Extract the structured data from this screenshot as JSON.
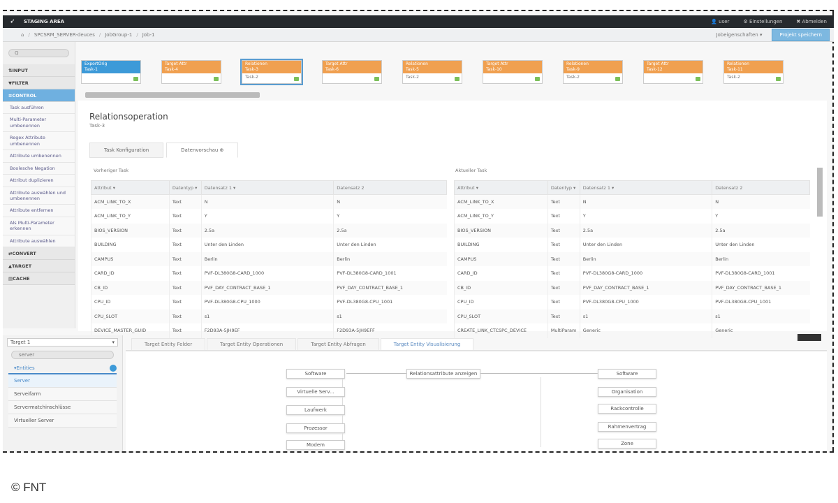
{
  "app": {
    "title": "STAGING AREA",
    "user": "user",
    "settings": "Einstellungen",
    "logout": "Abmelden"
  },
  "breadcrumb": {
    "items": [
      "SPCSRM_SERVER-deuces",
      "JobGroup-1",
      "Job-1"
    ],
    "dropdown": "Jobeigenschaften",
    "save": "Projekt speichern"
  },
  "sidebar": {
    "search": "Q",
    "categories": [
      "INPUT",
      "FILTER",
      "CONTROL"
    ],
    "items": [
      "Task ausführen",
      "Multi-Parameter umbenennen",
      "Regex Attribute umbenennen",
      "Attribute umbenennen",
      "Boolesche Negation",
      "Attribut duplizieren",
      "Attribute auswählen und umbenennen",
      "Attribute entfernen",
      "Als Multi-Parameter erkennen",
      "Attribute auswählen"
    ],
    "bottom_categories": [
      "CONVERT",
      "TARGET",
      "CACHE"
    ]
  },
  "tasks": [
    {
      "type": "ExportOrig",
      "name": "Task-1",
      "foot": "",
      "color": "blue"
    },
    {
      "type": "Target Attr",
      "name": "Task-4",
      "foot": "",
      "color": "orange"
    },
    {
      "type": "Relationen",
      "name": "Task-3",
      "foot": "Task-2",
      "color": "orange"
    },
    {
      "type": "Target Attr",
      "name": "Task-6",
      "foot": "",
      "color": "orange"
    },
    {
      "type": "Relationen",
      "name": "Task-5",
      "foot": "Task-2",
      "color": "orange"
    },
    {
      "type": "Target Attr",
      "name": "Task-10",
      "foot": "",
      "color": "orange"
    },
    {
      "type": "Relationen",
      "name": "Task-9",
      "foot": "Task-2",
      "color": "orange"
    },
    {
      "type": "Target Attr",
      "name": "Task-12",
      "foot": "",
      "color": "orange"
    },
    {
      "type": "Relationen",
      "name": "Task-11",
      "foot": "Task-2",
      "color": "orange"
    }
  ],
  "panel": {
    "title": "Relationsoperation",
    "subtitle": "Task-3",
    "tabs": [
      "Task Konfiguration",
      "Datenvorschau"
    ],
    "left_title": "Vorheriger Task",
    "right_title": "Aktueller Task",
    "left_headers": [
      "Attribut",
      "Datentyp",
      "Datensatz 1",
      "Datensatz 2"
    ],
    "right_headers": [
      "Attribut",
      "Datentyp",
      "Datensatz 1",
      "Datensatz 2"
    ],
    "left_rows": [
      [
        "ACM_LINK_TO_X",
        "Text",
        "N",
        "N"
      ],
      [
        "ACM_LINK_TO_Y",
        "Text",
        "Y",
        "Y"
      ],
      [
        "BIOS_VERSION",
        "Text",
        "2.5a",
        "2.5a"
      ],
      [
        "BUILDING",
        "Text",
        "Unter den Linden",
        "Unter den Linden"
      ],
      [
        "CAMPUS",
        "Text",
        "Berlin",
        "Berlin"
      ],
      [
        "CARD_ID",
        "Text",
        "PVF-DL380G8-CARD_1000",
        "PVF-DL380G8-CARD_1001"
      ],
      [
        "CB_ID",
        "Text",
        "PVF_DAY_CONTRACT_BASE_1",
        "PVF_DAY_CONTRACT_BASE_1"
      ],
      [
        "CPU_ID",
        "Text",
        "PVF-DL380G8-CPU_1000",
        "PVF-DL380G8-CPU_1001"
      ],
      [
        "CPU_SLOT",
        "Text",
        "s1",
        "s1"
      ],
      [
        "DEVICE_MASTER_GUID",
        "Text",
        "F2D93A-5JH9EF",
        "F2D93A-5JH9EFF"
      ]
    ],
    "right_rows": [
      [
        "ACM_LINK_TO_X",
        "Text",
        "N",
        "N"
      ],
      [
        "ACM_LINK_TO_Y",
        "Text",
        "Y",
        "Y"
      ],
      [
        "BIOS_VERSION",
        "Text",
        "2.5a",
        "2.5a"
      ],
      [
        "BUILDING",
        "Text",
        "Unter den Linden",
        "Unter den Linden"
      ],
      [
        "CAMPUS",
        "Text",
        "Berlin",
        "Berlin"
      ],
      [
        "CARD_ID",
        "Text",
        "PVF-DL380G8-CARD_1000",
        "PVF-DL380G8-CARD_1001"
      ],
      [
        "CB_ID",
        "Text",
        "PVF_DAY_CONTRACT_BASE_1",
        "PVF_DAY_CONTRACT_BASE_1"
      ],
      [
        "CPU_ID",
        "Text",
        "PVF-DL380G8-CPU_1000",
        "PVF-DL380G8-CPU_1001"
      ],
      [
        "CPU_SLOT",
        "Text",
        "s1",
        "s1"
      ],
      [
        "CREATE_LINK_CTCSPC_DEVICE",
        "MultiParam",
        "Generic",
        "Generic"
      ]
    ]
  },
  "bottom": {
    "select": "Target 1",
    "search": "server",
    "entities_label": "Entities",
    "entities": [
      "Server",
      "Serveifarm",
      "Servermatchinschlüsse",
      "Virtueller Server"
    ],
    "tabs": [
      "Target Entity Felder",
      "Target Entity Operationen",
      "Target Entity Abfragen",
      "Target Entity Visualisierung"
    ],
    "show_relations": "Relationsattribute anzeigen",
    "left_nodes": [
      "Software",
      "Virtuelle Serv...",
      "Laufwerk",
      "Prozessor",
      "Modem"
    ],
    "right_nodes": [
      "Software",
      "Organisation",
      "Rackcontrolle",
      "Rahmenvertrag",
      "Zone"
    ]
  },
  "copyright": "© FNT",
  "colors": {
    "accent": "#3d9ad8",
    "task": "#f0a050",
    "ok": "#7cc05a"
  }
}
